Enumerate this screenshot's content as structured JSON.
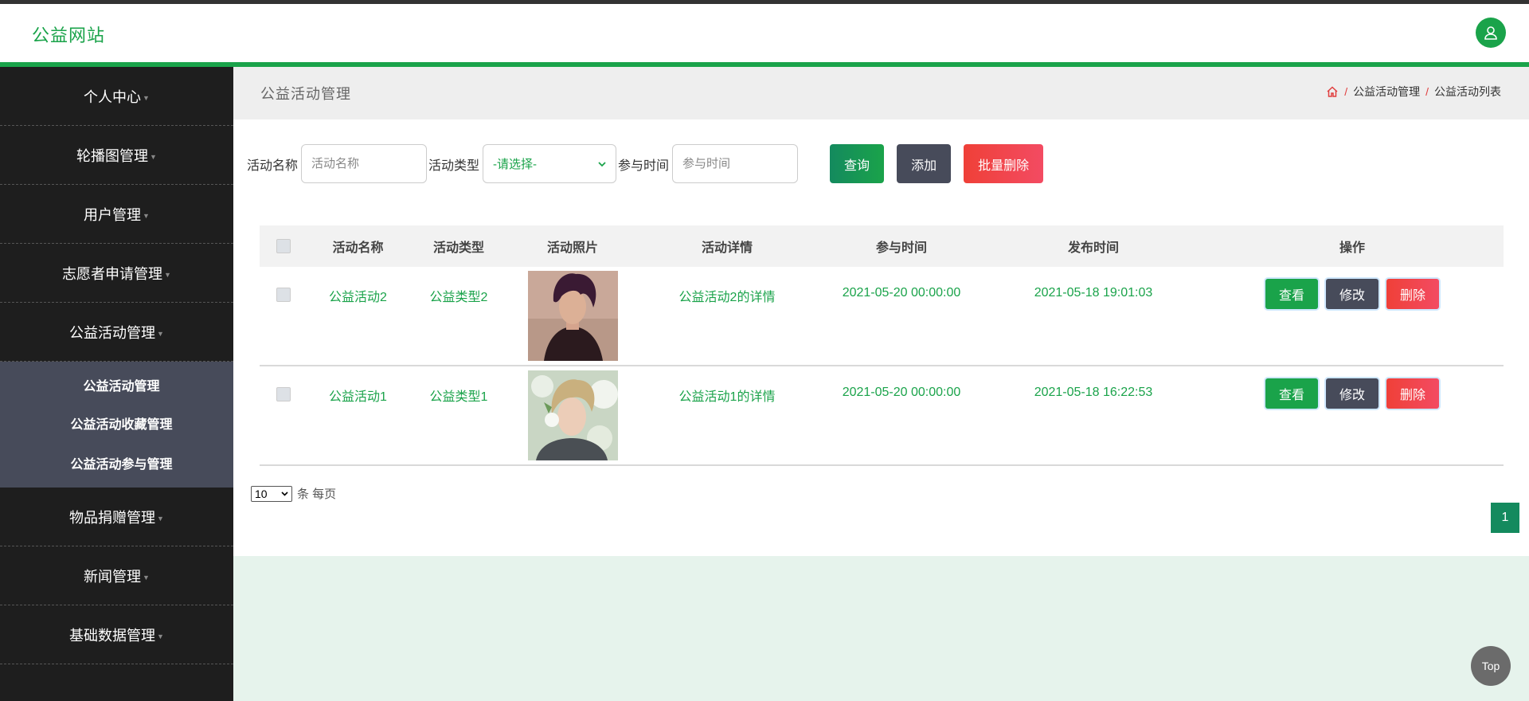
{
  "header": {
    "brand": "公益网站",
    "avatar_icon": "user-icon"
  },
  "sidebar": {
    "items": [
      {
        "label": "个人中心"
      },
      {
        "label": "轮播图管理"
      },
      {
        "label": "用户管理"
      },
      {
        "label": "志愿者申请管理"
      },
      {
        "label": "公益活动管理"
      },
      {
        "label": "物品捐赠管理"
      },
      {
        "label": "新闻管理"
      },
      {
        "label": "基础数据管理"
      }
    ],
    "submenu": [
      {
        "label": "公益活动管理"
      },
      {
        "label": "公益活动收藏管理"
      },
      {
        "label": "公益活动参与管理"
      }
    ]
  },
  "content": {
    "title": "公益活动管理",
    "breadcrumb": {
      "level1": "公益活动管理",
      "level2": "公益活动列表",
      "sep": "/"
    }
  },
  "search": {
    "name_label": "活动名称",
    "name_placeholder": "活动名称",
    "type_label": "活动类型",
    "type_selected": "-请选择-",
    "time_label": "参与时间",
    "time_placeholder": "参与时间",
    "query_btn": "查询",
    "add_btn": "添加",
    "batch_delete_btn": "批量删除"
  },
  "table": {
    "headers": {
      "name": "活动名称",
      "type": "活动类型",
      "photo": "活动照片",
      "detail": "活动详情",
      "time": "参与时间",
      "publish": "发布时间",
      "ops": "操作"
    },
    "rows": [
      {
        "name": "公益活动2",
        "type": "公益类型2",
        "detail": "公益活动2的详情",
        "time": "2021-05-20 00:00:00",
        "publish": "2021-05-18 19:01:03"
      },
      {
        "name": "公益活动1",
        "type": "公益类型1",
        "detail": "公益活动1的详情",
        "time": "2021-05-20 00:00:00",
        "publish": "2021-05-18 16:22:53"
      }
    ],
    "actions": {
      "view": "查看",
      "edit": "修改",
      "delete": "删除"
    }
  },
  "pagination": {
    "page_size": "10",
    "per_page_label": "条 每页",
    "current_page": "1"
  },
  "back_to_top": "Top",
  "colors": {
    "accent": "#1aa34a",
    "dark": "#474b5a",
    "danger": "#f34b62",
    "sidebar": "#1e1e1e"
  }
}
